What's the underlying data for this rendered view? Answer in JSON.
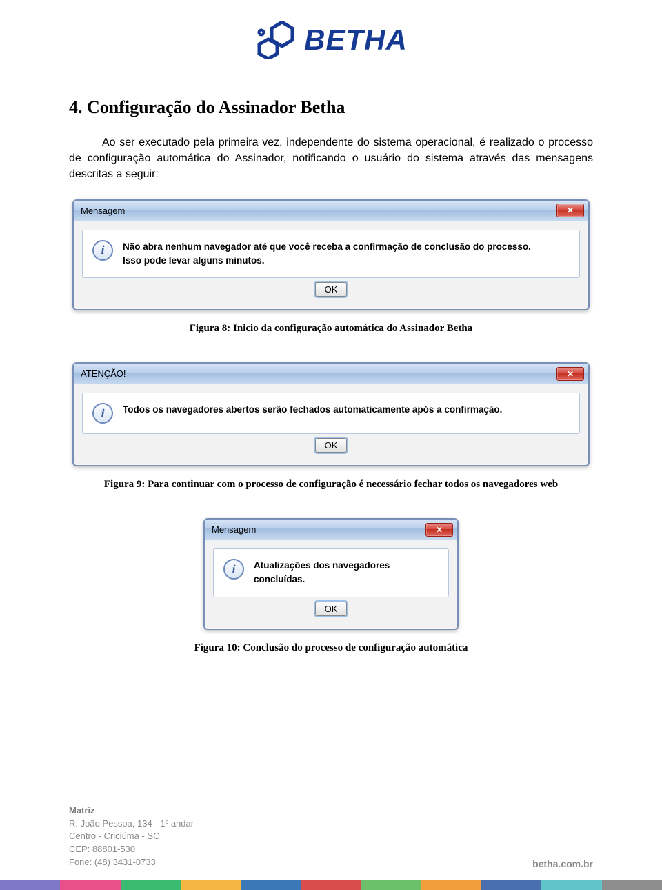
{
  "logo": {
    "text": "BETHA"
  },
  "section_title": "4. Configuração do Assinador Betha",
  "body_text": "Ao ser executado pela primeira vez, independente do sistema operacional, é realizado o processo de configuração automática do Assinador, notificando o usuário do sistema através das mensagens descritas a seguir:",
  "dialog1": {
    "title": "Mensagem",
    "line1": "Não abra nenhum navegador até que você receba a confirmação de conclusão do processo.",
    "line2": "Isso pode levar alguns minutos.",
    "ok": "OK"
  },
  "caption1": "Figura 8: Inicio da configuração automática do Assinador Betha",
  "dialog2": {
    "title": "ATENÇÃO!",
    "line1": "Todos os navegadores abertos serão fechados automaticamente após a confirmação.",
    "ok": "OK"
  },
  "caption2": "Figura 9: Para continuar com o processo de configuração é necessário fechar todos os navegadores web",
  "dialog3": {
    "title": "Mensagem",
    "line1": "Atualizações dos navegadores concluídas.",
    "ok": "OK"
  },
  "caption3": "Figura 10: Conclusão do processo de configuração automática",
  "footer": {
    "matriz": "Matriz",
    "line1": "R. João Pessoa, 134 - 1º andar",
    "line2": "Centro - Criciúma - SC",
    "line3": "CEP: 88801-530",
    "line4": "Fone: (48) 3431-0733",
    "url": "betha.com.br"
  },
  "stripe_colors": [
    "#7f77c7",
    "#e84f8b",
    "#3bbb6f",
    "#f6b642",
    "#3b78b8",
    "#d94d4d",
    "#6cc069",
    "#f29c3b",
    "#4a6fb0",
    "#60c4c9",
    "#8e8e8e"
  ]
}
